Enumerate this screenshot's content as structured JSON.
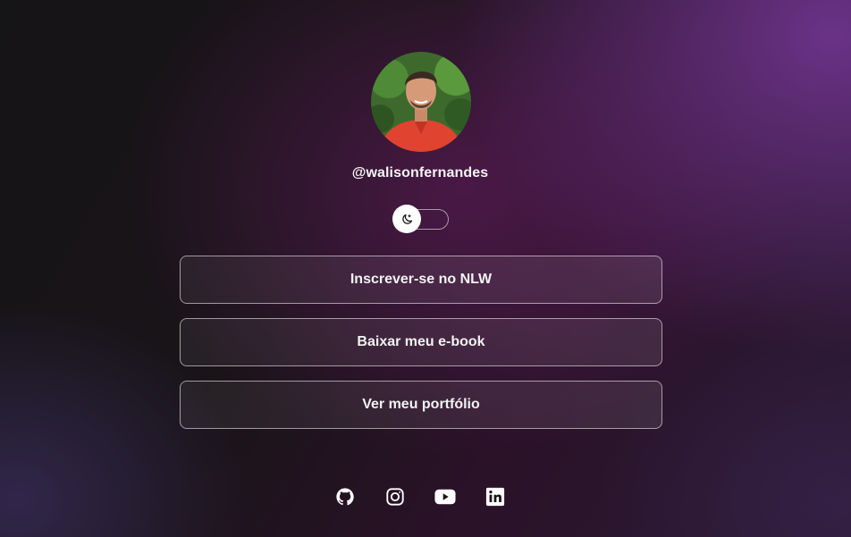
{
  "profile": {
    "username": "@walisonfernandes",
    "avatar_icon": "profile-photo"
  },
  "theme_toggle": {
    "icon": "moon-icon",
    "state": "dark"
  },
  "links": [
    {
      "label": "Inscrever-se no NLW"
    },
    {
      "label": "Baixar meu e-book"
    },
    {
      "label": "Ver meu portfólio"
    }
  ],
  "socials": [
    {
      "icon": "github-icon"
    },
    {
      "icon": "instagram-icon"
    },
    {
      "icon": "youtube-icon"
    },
    {
      "icon": "linkedin-icon"
    }
  ],
  "colors": {
    "text": "#f2f2f2",
    "accent_purple": "#6e348c",
    "background_dark": "#151416"
  }
}
